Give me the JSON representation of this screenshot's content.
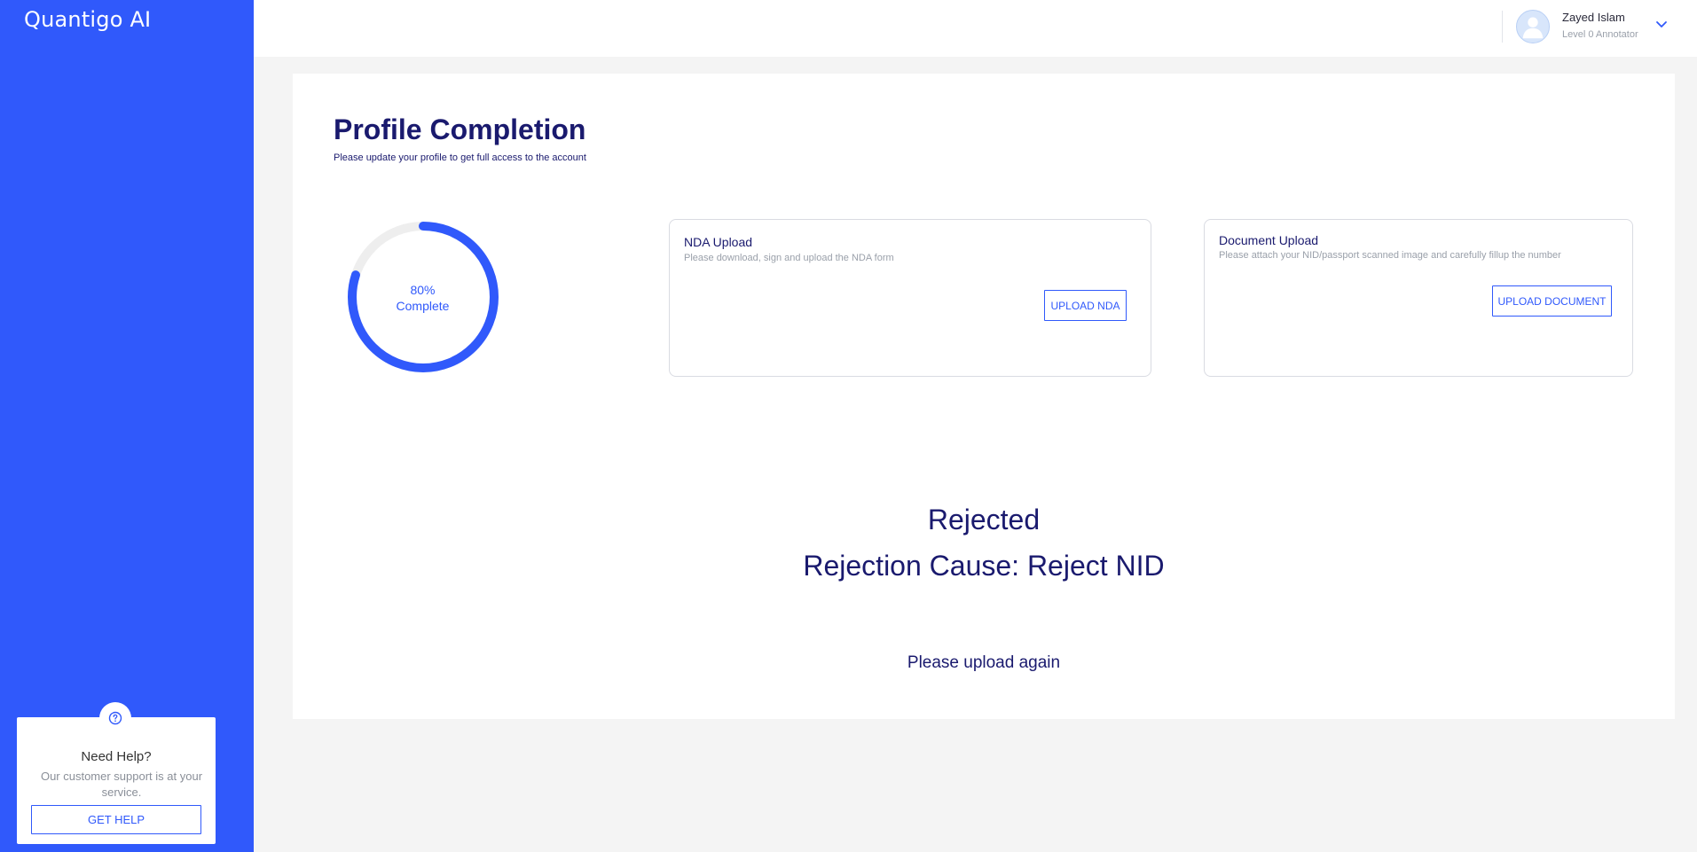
{
  "app": {
    "brand": "Quantigo AI",
    "accent_color": "#3059fb",
    "title_color": "#1a1a6e"
  },
  "user": {
    "name": "Zayed Islam",
    "level": "Level 0 Annotator",
    "avatar_icon": "user-avatar-icon",
    "menu_icon": "chevron-down-icon"
  },
  "help": {
    "icon": "question-circle-icon",
    "title": "Need Help?",
    "text": "Our customer support is at your service.",
    "button_label": "GET HELP"
  },
  "profile": {
    "title": "Profile Completion",
    "subtitle": "Please update your profile to get full access to the account",
    "progress_percent": 80,
    "progress_label": "80%",
    "progress_caption": "Complete"
  },
  "nda": {
    "title": "NDA Upload",
    "description": "Please download, sign and upload the NDA form",
    "button_label": "UPLOAD NDA"
  },
  "document": {
    "title": "Document Upload",
    "description": "Please attach your NID/passport scanned image and carefully fillup the number",
    "button_label": "UPLOAD DOCUMENT"
  },
  "status": {
    "title": "Rejected",
    "cause": "Rejection Cause: Reject NID",
    "note": "Please upload again"
  }
}
